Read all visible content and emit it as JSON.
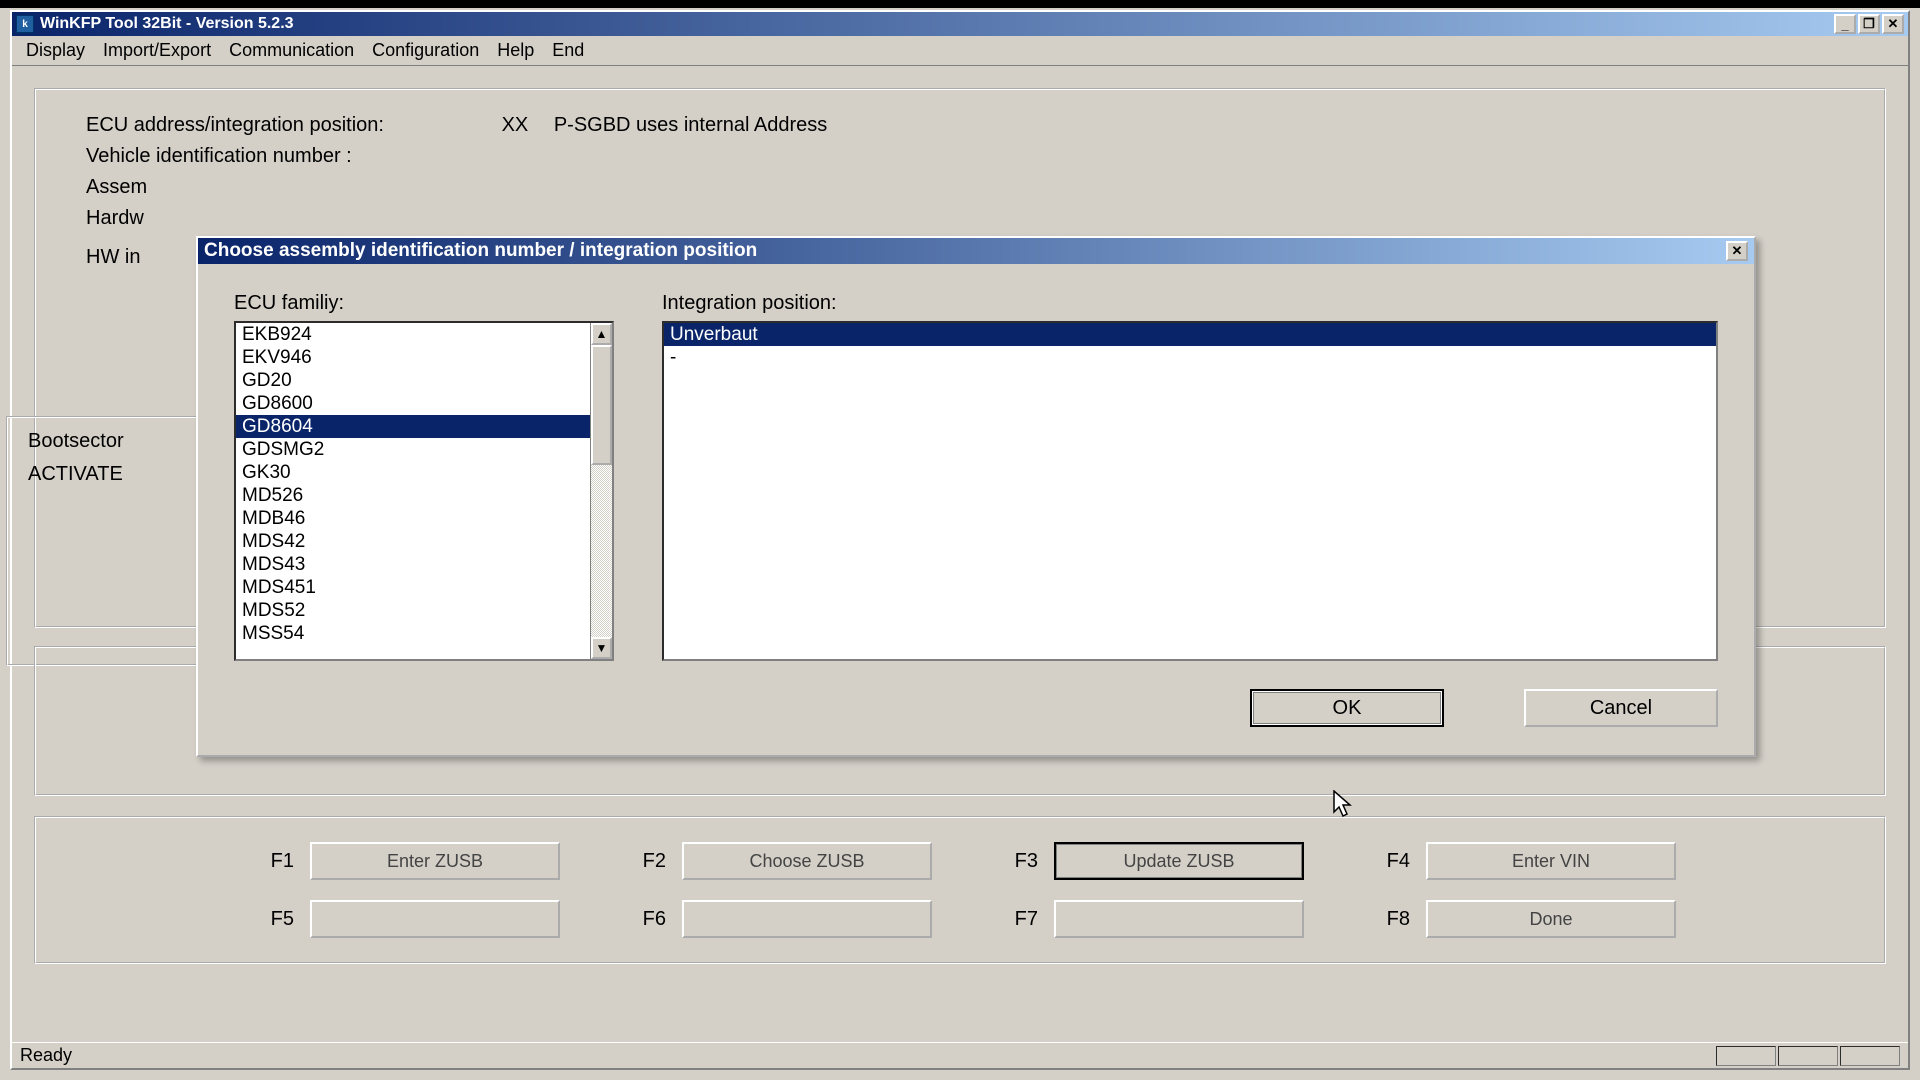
{
  "window": {
    "title": "WinKFP Tool 32Bit - Version 5.2.3"
  },
  "menu": {
    "display": "Display",
    "import_export": "Import/Export",
    "communication": "Communication",
    "configuration": "Configuration",
    "help": "Help",
    "end": "End"
  },
  "info": {
    "ecu_addr_label": "ECU address/integration position:",
    "ecu_addr_value1": "XX",
    "ecu_addr_value2": "P-SGBD uses internal Address",
    "vin_label": "Vehicle identification number :",
    "assembly_label": "Assem",
    "hardware_label": "Hardw",
    "hwinterface_label": "HW in",
    "bootsector_label": "Bootsector",
    "activate_label": "ACTIVATE"
  },
  "dialog": {
    "title": "Choose assembly identification number / integration position",
    "ecu_family_label": "ECU familiy:",
    "integration_label": "Integration position:",
    "ecu_family_items": [
      "EKB924",
      "EKV946",
      "GD20",
      "GD8600",
      "GD8604",
      "GDSMG2",
      "GK30",
      "MD526",
      "MDB46",
      "MDS42",
      "MDS43",
      "MDS451",
      "MDS52",
      "MSS54"
    ],
    "ecu_family_selected": "GD8604",
    "integration_items": [
      "Unverbaut",
      "-"
    ],
    "integration_selected": "Unverbaut",
    "ok": "OK",
    "cancel": "Cancel"
  },
  "fkeys": {
    "f1": "F1",
    "f1_btn": "Enter ZUSB",
    "f2": "F2",
    "f2_btn": "Choose ZUSB",
    "f3": "F3",
    "f3_btn": "Update ZUSB",
    "f4": "F4",
    "f4_btn": "Enter VIN",
    "f5": "F5",
    "f5_btn": "",
    "f6": "F6",
    "f6_btn": "",
    "f7": "F7",
    "f7_btn": "",
    "f8": "F8",
    "f8_btn": "Done"
  },
  "status": "Ready"
}
